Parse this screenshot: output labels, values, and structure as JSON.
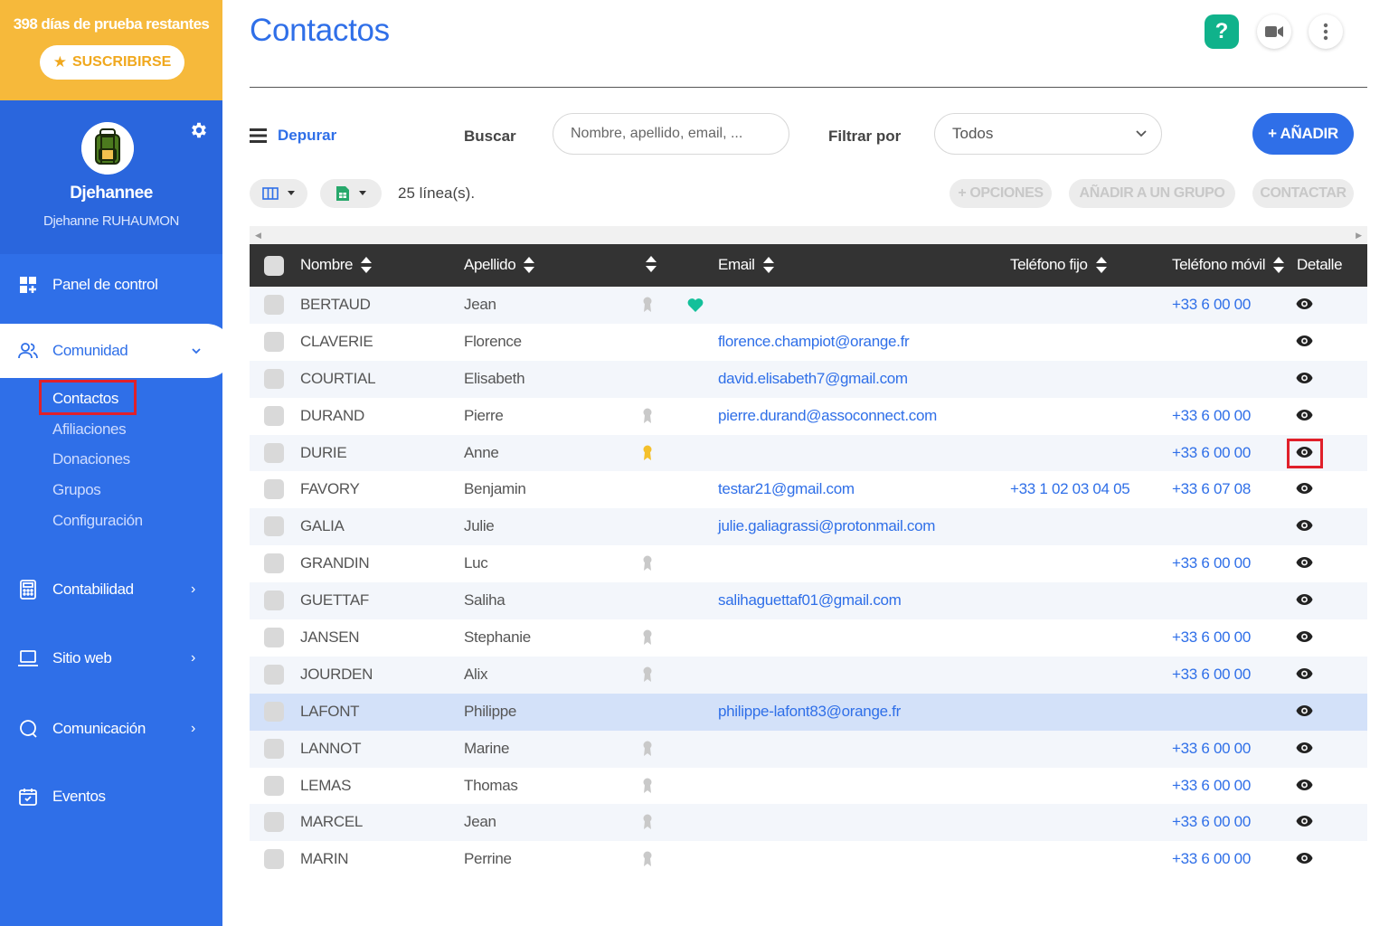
{
  "trial": {
    "text": "398 días de prueba restantes",
    "subscribe_label": "SUSCRIBIRSE"
  },
  "profile": {
    "name": "Djehannee",
    "subtitle": "Djehanne RUHAUMON"
  },
  "nav": {
    "panel": "Panel de control",
    "comunidad": "Comunidad",
    "sub": [
      "Contactos",
      "Afiliaciones",
      "Donaciones",
      "Grupos",
      "Configuración"
    ],
    "contabilidad": "Contabilidad",
    "sitio": "Sitio web",
    "comunicacion": "Comunicación",
    "eventos": "Eventos"
  },
  "page": {
    "title": "Contactos"
  },
  "toolbar": {
    "depurar": "Depurar",
    "buscar": "Buscar",
    "search_placeholder": "Nombre, apellido, email, ...",
    "filtrar": "Filtrar por",
    "filter_value": "Todos",
    "add": "+ AÑADIR",
    "lines": "25 línea(s).",
    "opciones": "+ OPCIONES",
    "grupo": "AÑADIR A UN GRUPO",
    "contactar": "CONTACTAR"
  },
  "table": {
    "headers": {
      "nombre": "Nombre",
      "apellido": "Apellido",
      "email": "Email",
      "fijo": "Teléfono fijo",
      "movil": "Teléfono móvil",
      "detalle": "Detalle"
    },
    "rows": [
      {
        "nombre": "BERTAUD",
        "apellido": "Jean",
        "medal": "grey",
        "heart": true,
        "email": "",
        "fijo": "",
        "movil": "+33 6 00 00"
      },
      {
        "nombre": "CLAVERIE",
        "apellido": "Florence",
        "medal": "",
        "heart": false,
        "email": "florence.champiot@orange.fr",
        "fijo": "",
        "movil": ""
      },
      {
        "nombre": "COURTIAL",
        "apellido": "Elisabeth",
        "medal": "",
        "heart": false,
        "email": "david.elisabeth7@gmail.com",
        "fijo": "",
        "movil": ""
      },
      {
        "nombre": "DURAND",
        "apellido": "Pierre",
        "medal": "grey",
        "heart": false,
        "email": "pierre.durand@assoconnect.com",
        "fijo": "",
        "movil": "+33 6 00 00"
      },
      {
        "nombre": "DURIE",
        "apellido": "Anne",
        "medal": "gold",
        "heart": false,
        "email": "",
        "fijo": "",
        "movil": "+33 6 00 00"
      },
      {
        "nombre": "FAVORY",
        "apellido": "Benjamin",
        "medal": "",
        "heart": false,
        "email": "testar21@gmail.com",
        "fijo": "+33 1 02 03 04 05",
        "movil": "+33 6 07 08"
      },
      {
        "nombre": "GALIA",
        "apellido": "Julie",
        "medal": "",
        "heart": false,
        "email": "julie.galiagrassi@protonmail.com",
        "fijo": "",
        "movil": ""
      },
      {
        "nombre": "GRANDIN",
        "apellido": "Luc",
        "medal": "grey",
        "heart": false,
        "email": "",
        "fijo": "",
        "movil": "+33 6 00 00"
      },
      {
        "nombre": "GUETTAF",
        "apellido": "Saliha",
        "medal": "",
        "heart": false,
        "email": "salihaguettaf01@gmail.com",
        "fijo": "",
        "movil": ""
      },
      {
        "nombre": "JANSEN",
        "apellido": "Stephanie",
        "medal": "grey",
        "heart": false,
        "email": "",
        "fijo": "",
        "movil": "+33 6 00 00"
      },
      {
        "nombre": "JOURDEN",
        "apellido": "Alix",
        "medal": "grey",
        "heart": false,
        "email": "",
        "fijo": "",
        "movil": "+33 6 00 00"
      },
      {
        "nombre": "LAFONT",
        "apellido": "Philippe",
        "medal": "",
        "heart": false,
        "email": "philippe-lafont83@orange.fr",
        "fijo": "",
        "movil": "",
        "selected": true
      },
      {
        "nombre": "LANNOT",
        "apellido": "Marine",
        "medal": "grey",
        "heart": false,
        "email": "",
        "fijo": "",
        "movil": "+33 6 00 00"
      },
      {
        "nombre": "LEMAS",
        "apellido": "Thomas",
        "medal": "grey",
        "heart": false,
        "email": "",
        "fijo": "",
        "movil": "+33 6 00 00"
      },
      {
        "nombre": "MARCEL",
        "apellido": "Jean",
        "medal": "grey",
        "heart": false,
        "email": "",
        "fijo": "",
        "movil": "+33 6 00 00"
      },
      {
        "nombre": "MARIN",
        "apellido": "Perrine",
        "medal": "grey",
        "heart": false,
        "email": "",
        "fijo": "",
        "movil": "+33 6 00 00"
      }
    ]
  },
  "colors": {
    "primary": "#2f6fe8",
    "trial": "#f6b93b",
    "help": "#10b28b",
    "heart": "#13c09a",
    "medal_gold": "#f4c02b",
    "highlight": "#e0202a"
  },
  "icons": [
    "star-icon",
    "gear-icon",
    "dashboard-icon",
    "users-icon",
    "calculator-icon",
    "laptop-icon",
    "chat-icon",
    "calendar-icon",
    "help-icon",
    "video-icon",
    "more-icon",
    "menu-icon",
    "columns-icon",
    "export-icon",
    "sort-icon",
    "medal-icon",
    "heart-icon",
    "eye-icon"
  ]
}
